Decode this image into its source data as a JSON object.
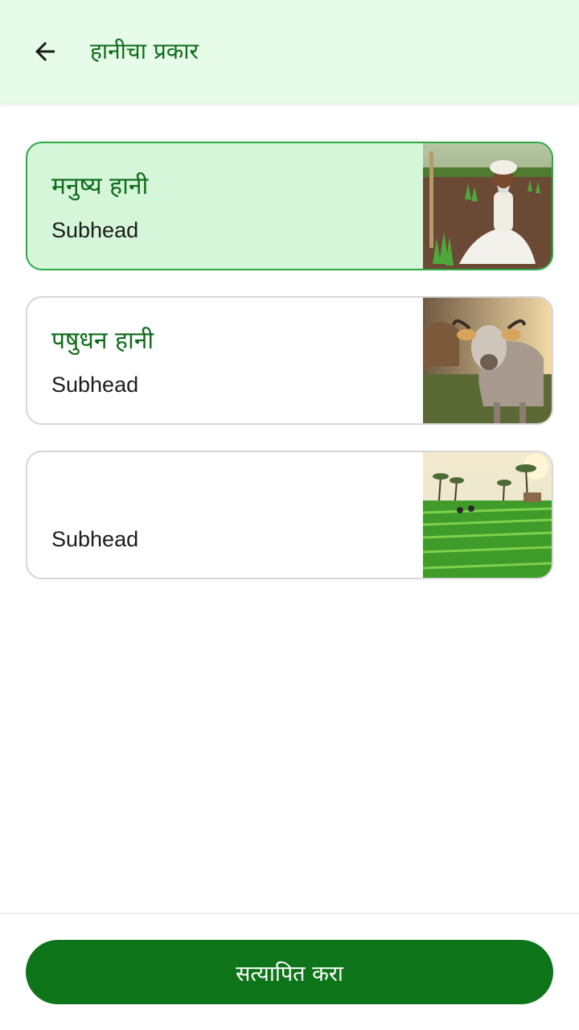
{
  "header": {
    "title": "हानीचा प्रकार",
    "back_icon": "arrow-left-icon"
  },
  "options": [
    {
      "title": "मनुष्य हानी",
      "subhead": "Subhead",
      "selected": true,
      "image": "farmer-in-field-photo"
    },
    {
      "title": "पषुधन हानी",
      "subhead": "Subhead",
      "selected": false,
      "image": "cow-photo"
    },
    {
      "title": "",
      "subhead": "Subhead",
      "selected": false,
      "image": "rice-field-photo"
    }
  ],
  "confirm_button": {
    "label": "सत्यापित करा"
  },
  "colors": {
    "app_bar_bg": "#e6fbe8",
    "primary_text": "#0e6b1b",
    "selected_bg": "#d5f6d8",
    "selected_border": "#2aa844",
    "button_bg": "#0e7419"
  }
}
